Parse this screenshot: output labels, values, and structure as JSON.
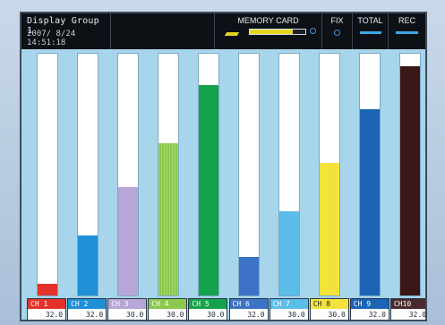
{
  "status_bar": {
    "group_title": "Display Group 1",
    "datetime": "2007/ 8/24 14:51:18",
    "memory_card_label": "MEMORY CARD",
    "memory_card_usage": 0.78,
    "fix_label": "FIX",
    "total_label": "TOTAL",
    "rec_label": "REC",
    "colors": {
      "memory_fill": "#e6d725",
      "indicator": "#3ba8e8"
    }
  },
  "channels": [
    {
      "name": "CH 1",
      "value": "32.0",
      "level": 0.05,
      "color": "#e53228",
      "label_color": "#e53228",
      "text_color": "#ffffff",
      "pattern": "solid"
    },
    {
      "name": "CH 2",
      "value": "32.0",
      "level": 0.25,
      "color": "#1f90d8",
      "label_color": "#1f90d8",
      "text_color": "#ffffff",
      "pattern": "solid"
    },
    {
      "name": "CH 3",
      "value": "30.0",
      "level": 0.45,
      "color": "#b7a6d8",
      "label_color": "#b7a6d8",
      "text_color": "#ffffff",
      "pattern": "solid"
    },
    {
      "name": "CH 4",
      "value": "30.0",
      "level": 0.63,
      "color": "#8ac94a",
      "label_color": "#8ac94a",
      "text_color": "#ffffff",
      "pattern": "striped"
    },
    {
      "name": "CH 5",
      "value": "30.0",
      "level": 0.87,
      "color": "#14a34c",
      "label_color": "#14a34c",
      "text_color": "#ffffff",
      "pattern": "solid"
    },
    {
      "name": "CH 6",
      "value": "32.0",
      "level": 0.16,
      "color": "#3c73c6",
      "label_color": "#3c73c6",
      "text_color": "#ffffff",
      "pattern": "solid"
    },
    {
      "name": "CH 7",
      "value": "30.0",
      "level": 0.35,
      "color": "#5cbcea",
      "label_color": "#5cbcea",
      "text_color": "#ffffff",
      "pattern": "solid"
    },
    {
      "name": "CH 8",
      "value": "30.0",
      "level": 0.55,
      "color": "#f3e23b",
      "label_color": "#f3e23b",
      "text_color": "#1b2433",
      "pattern": "solid"
    },
    {
      "name": "CH 9",
      "value": "32.0",
      "level": 0.77,
      "color": "#1b64b6",
      "label_color": "#1b64b6",
      "text_color": "#ffffff",
      "pattern": "solid"
    },
    {
      "name": "CH10",
      "value": "32.0",
      "level": 0.95,
      "color": "#3a1617",
      "label_color": "#4a2a2c",
      "text_color": "#ffffff",
      "pattern": "solid"
    }
  ]
}
